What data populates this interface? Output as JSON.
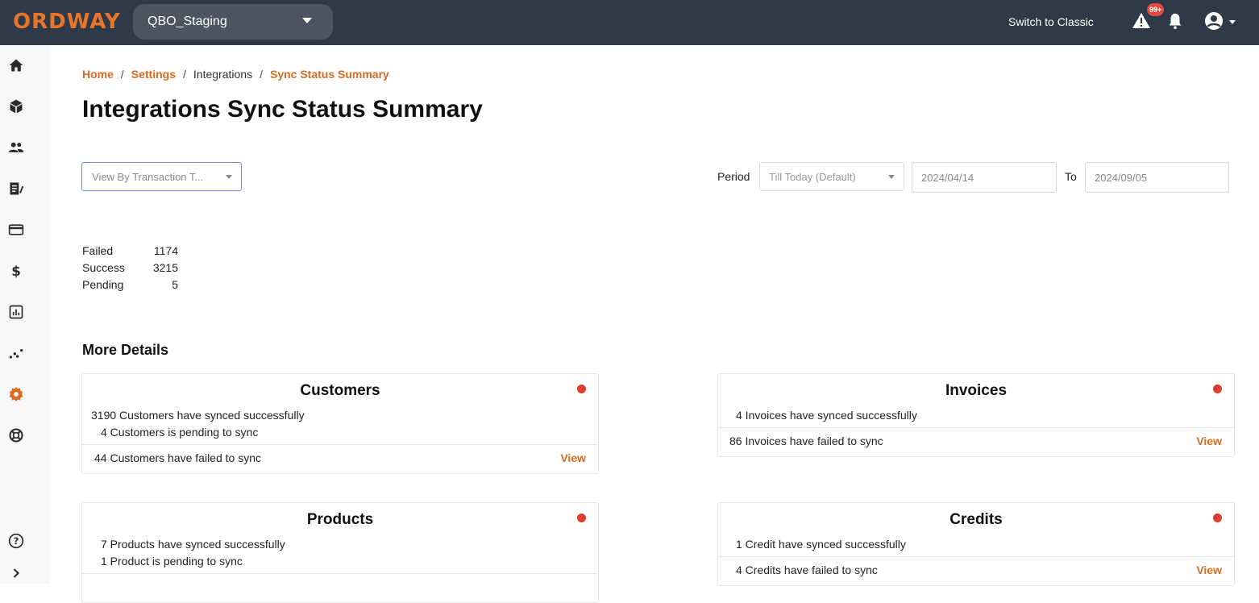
{
  "header": {
    "logo": "ORDWAY",
    "environment": "QBO_Staging",
    "switch_label": "Switch to Classic",
    "alert_badge": "99+"
  },
  "colors": {
    "accent": "#d96a1f",
    "topbar": "#2e3a47",
    "status_dot": "#e03b2e"
  },
  "nav": {
    "items": [
      "home-icon",
      "box-icon",
      "users-icon",
      "billing-icon",
      "card-icon",
      "dollar-icon",
      "report-icon",
      "analytics-icon",
      "settings-icon",
      "support-icon"
    ],
    "bottom": [
      "help-icon",
      "expand-icon"
    ]
  },
  "breadcrumb": {
    "home": "Home",
    "settings": "Settings",
    "integrations": "Integrations",
    "current": "Sync Status Summary",
    "sep": "/"
  },
  "page": {
    "title": "Integrations Sync Status Summary"
  },
  "filters": {
    "view_by": "View By Transaction T...",
    "period_label": "Period",
    "period_value": "Till Today (Default)",
    "date_from": "2024/04/14",
    "to_label": "To",
    "date_to": "2024/09/05"
  },
  "summary": [
    {
      "label": "Failed",
      "value": "1174"
    },
    {
      "label": "Success",
      "value": "3215"
    },
    {
      "label": "Pending",
      "value": "5"
    }
  ],
  "more_details": "More Details",
  "cards": {
    "customers": {
      "title": "Customers",
      "synced": "3190 Customers have synced successfully",
      "pending": "4 Customers is pending to sync",
      "failed": "44 Customers have failed to sync",
      "view": "View"
    },
    "invoices": {
      "title": "Invoices",
      "synced": "4 Invoices have synced successfully",
      "failed": "86 Invoices have failed to sync",
      "view": "View"
    },
    "products": {
      "title": "Products",
      "synced": "7 Products have synced successfully",
      "pending": "1 Product is pending to sync",
      "failed": "",
      "view": ""
    },
    "credits": {
      "title": "Credits",
      "synced": "1 Credit have synced successfully",
      "failed": "4 Credits have failed to sync",
      "view": "View"
    }
  }
}
